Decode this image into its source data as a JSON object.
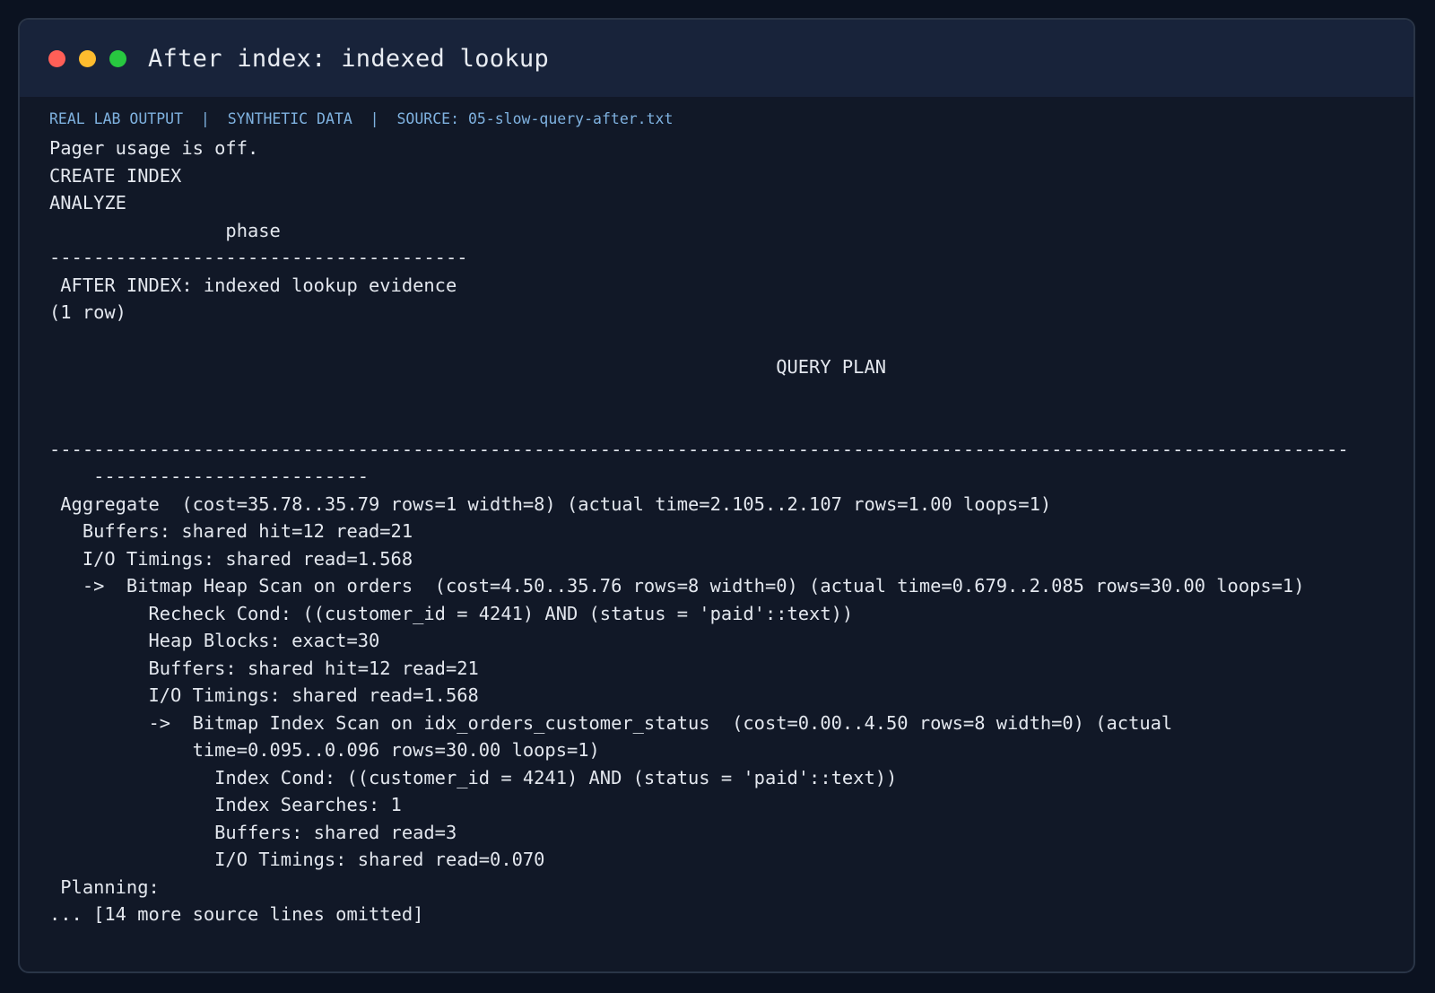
{
  "window": {
    "title": "After index: indexed lookup",
    "traffic_lights": [
      {
        "name": "close-dot",
        "color": "#ff5f57"
      },
      {
        "name": "minimize-dot",
        "color": "#febc2e"
      },
      {
        "name": "zoom-dot",
        "color": "#28c840"
      }
    ]
  },
  "source": {
    "label_real": "REAL LAB OUTPUT",
    "label_synthetic": "SYNTHETIC DATA",
    "label_source": "SOURCE: 05-slow-query-after.txt",
    "separator": "|"
  },
  "output_lines": [
    "Pager usage is off.",
    "CREATE INDEX",
    "ANALYZE",
    "                phase",
    "--------------------------------------",
    " AFTER INDEX: indexed lookup evidence",
    "(1 row)",
    "",
    "                                                                  QUERY PLAN",
    "",
    "",
    "----------------------------------------------------------------------------------------------------------------------",
    "    -------------------------",
    " Aggregate  (cost=35.78..35.79 rows=1 width=8) (actual time=2.105..2.107 rows=1.00 loops=1)",
    "   Buffers: shared hit=12 read=21",
    "   I/O Timings: shared read=1.568",
    "   ->  Bitmap Heap Scan on orders  (cost=4.50..35.76 rows=8 width=0) (actual time=0.679..2.085 rows=30.00 loops=1)",
    "         Recheck Cond: ((customer_id = 4241) AND (status = 'paid'::text))",
    "         Heap Blocks: exact=30",
    "         Buffers: shared hit=12 read=21",
    "         I/O Timings: shared read=1.568",
    "         ->  Bitmap Index Scan on idx_orders_customer_status  (cost=0.00..4.50 rows=8 width=0) (actual",
    "             time=0.095..0.096 rows=30.00 loops=1)",
    "               Index Cond: ((customer_id = 4241) AND (status = 'paid'::text))",
    "               Index Searches: 1",
    "               Buffers: shared read=3",
    "               I/O Timings: shared read=0.070",
    " Planning:",
    "... [14 more source lines omitted]"
  ]
}
